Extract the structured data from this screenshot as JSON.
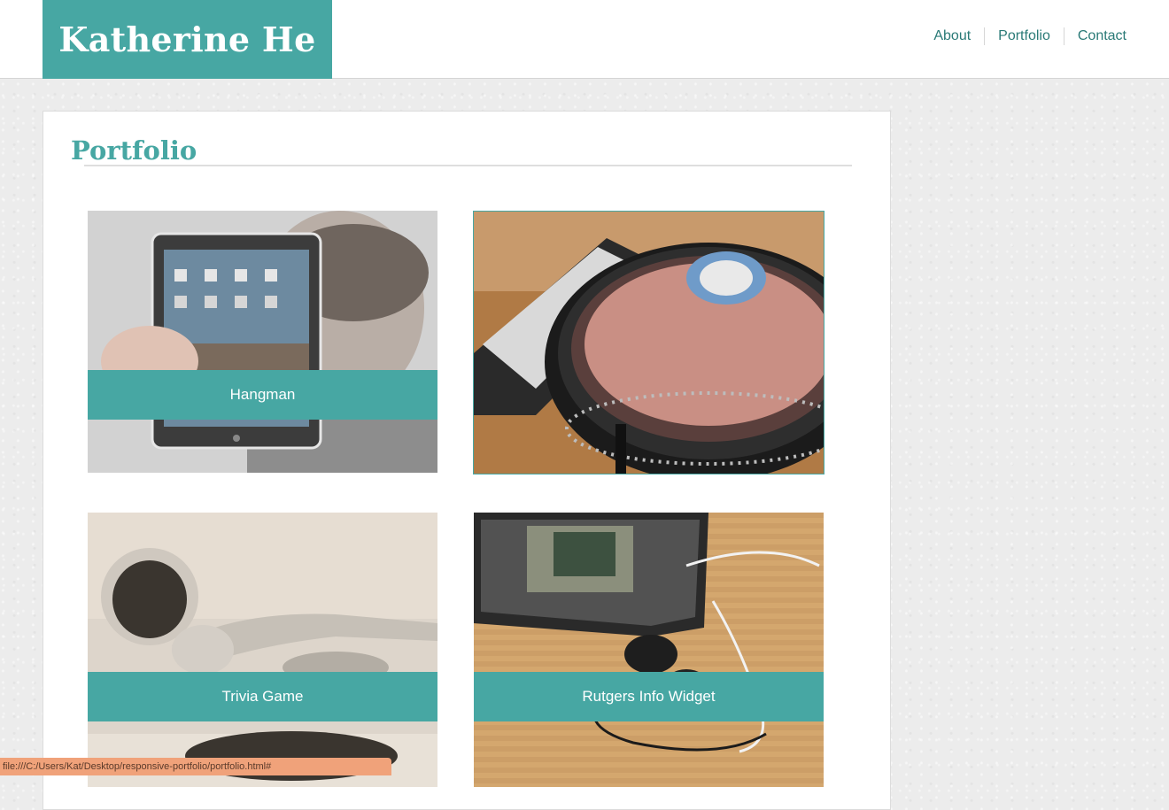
{
  "site": {
    "name": "Katherine He"
  },
  "nav": {
    "items": [
      {
        "label": "About"
      },
      {
        "label": "Portfolio"
      },
      {
        "label": "Contact"
      }
    ]
  },
  "page": {
    "title": "Portfolio"
  },
  "portfolio": {
    "items": [
      {
        "caption": "Hangman",
        "image": "person-holding-tablet-photo"
      },
      {
        "caption": "",
        "image": "dj-turntable-photo"
      },
      {
        "caption": "Trivia Game",
        "image": "earbuds-photo"
      },
      {
        "caption": "Rutgers Info Widget",
        "image": "phone-with-earphones-photo"
      }
    ]
  },
  "status": {
    "url": "file:///C:/Users/Kat/Desktop/responsive-portfolio/portfolio.html#"
  },
  "colors": {
    "accent": "#47a7a3",
    "link": "#2a7a77",
    "status_bar": "#f0a27a"
  }
}
